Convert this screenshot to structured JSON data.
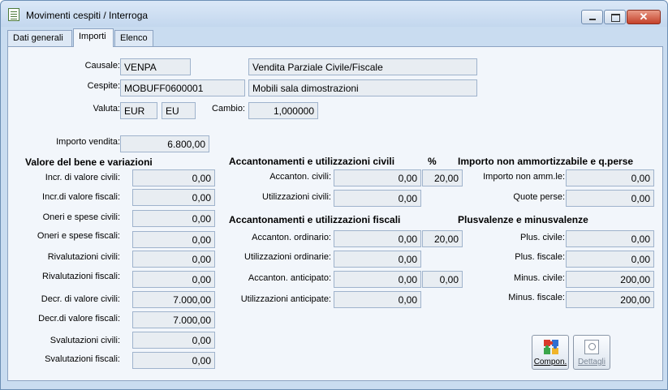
{
  "window": {
    "title": "Movimenti cespiti / Interroga"
  },
  "tabs": [
    "Dati generali",
    "Importi",
    "Elenco"
  ],
  "header": {
    "causale_label": "Causale:",
    "causale_code": "VENPA",
    "causale_desc": "Vendita Parziale Civile/Fiscale",
    "cespite_label": "Cespite:",
    "cespite_code": "MOBUFF0600001",
    "cespite_desc": "Mobili sala dimostrazioni",
    "valuta_label": "Valuta:",
    "valuta_code": "EUR",
    "valuta_symbol": "EU",
    "cambio_label": "Cambio:",
    "cambio_value": "1,000000"
  },
  "vendita": {
    "label": "Importo vendita:",
    "value": "6.800,00"
  },
  "valore": {
    "title": "Valore del bene e variazioni",
    "rows": [
      {
        "label": "Incr. di valore civili:",
        "value": "0,00"
      },
      {
        "label": "Incr.di valore fiscali:",
        "value": "0,00"
      },
      {
        "label": "Oneri e spese civili:",
        "value": "0,00"
      },
      {
        "label": "Oneri e spese fiscali:",
        "value": "0,00"
      },
      {
        "label": "Rivalutazioni civili:",
        "value": "0,00"
      },
      {
        "label": "Rivalutazioni fiscali:",
        "value": "0,00"
      },
      {
        "label": "Decr. di valore civili:",
        "value": "7.000,00"
      },
      {
        "label": "Decr.di valore fiscali:",
        "value": "7.000,00"
      },
      {
        "label": "Svalutazioni civili:",
        "value": "0,00"
      },
      {
        "label": "Svalutazioni fiscali:",
        "value": "0,00"
      }
    ]
  },
  "civili": {
    "title": "Accantonamenti e utilizzazioni civili",
    "pct_header": "%",
    "accanton_label": "Accanton. civili:",
    "accanton_value": "0,00",
    "accanton_pct": "20,00",
    "utilizz_label": "Utilizzazioni civili:",
    "utilizz_value": "0,00"
  },
  "fiscali": {
    "title": "Accantonamenti e utilizzazioni fiscali",
    "ord_label": "Accanton. ordinario:",
    "ord_value": "0,00",
    "ord_pct": "20,00",
    "util_ord_label": "Utilizzazioni ordinarie:",
    "util_ord_value": "0,00",
    "ant_label": "Accanton. anticipato:",
    "ant_value": "0,00",
    "ant_pct": "0,00",
    "util_ant_label": "Utilizzazioni anticipate:",
    "util_ant_value": "0,00"
  },
  "nonamm": {
    "title": "Importo non ammortizzabile e q.perse",
    "importo_label": "Importo non amm.le:",
    "importo_value": "0,00",
    "quote_label": "Quote perse:",
    "quote_value": "0,00"
  },
  "plus": {
    "title": "Plusvalenze e minusvalenze",
    "plus_civ_label": "Plus. civile:",
    "plus_civ_value": "0,00",
    "plus_fis_label": "Plus. fiscale:",
    "plus_fis_value": "0,00",
    "minus_civ_label": "Minus. civile:",
    "minus_civ_value": "200,00",
    "minus_fis_label": "Minus. fiscale:",
    "minus_fis_value": "200,00"
  },
  "buttons": {
    "compon": "Compon.",
    "dettagli": "Dettagli"
  },
  "icons": {
    "app": "document-icon",
    "compon": "puzzle-icon",
    "dettagli": "magnifier-icon"
  }
}
